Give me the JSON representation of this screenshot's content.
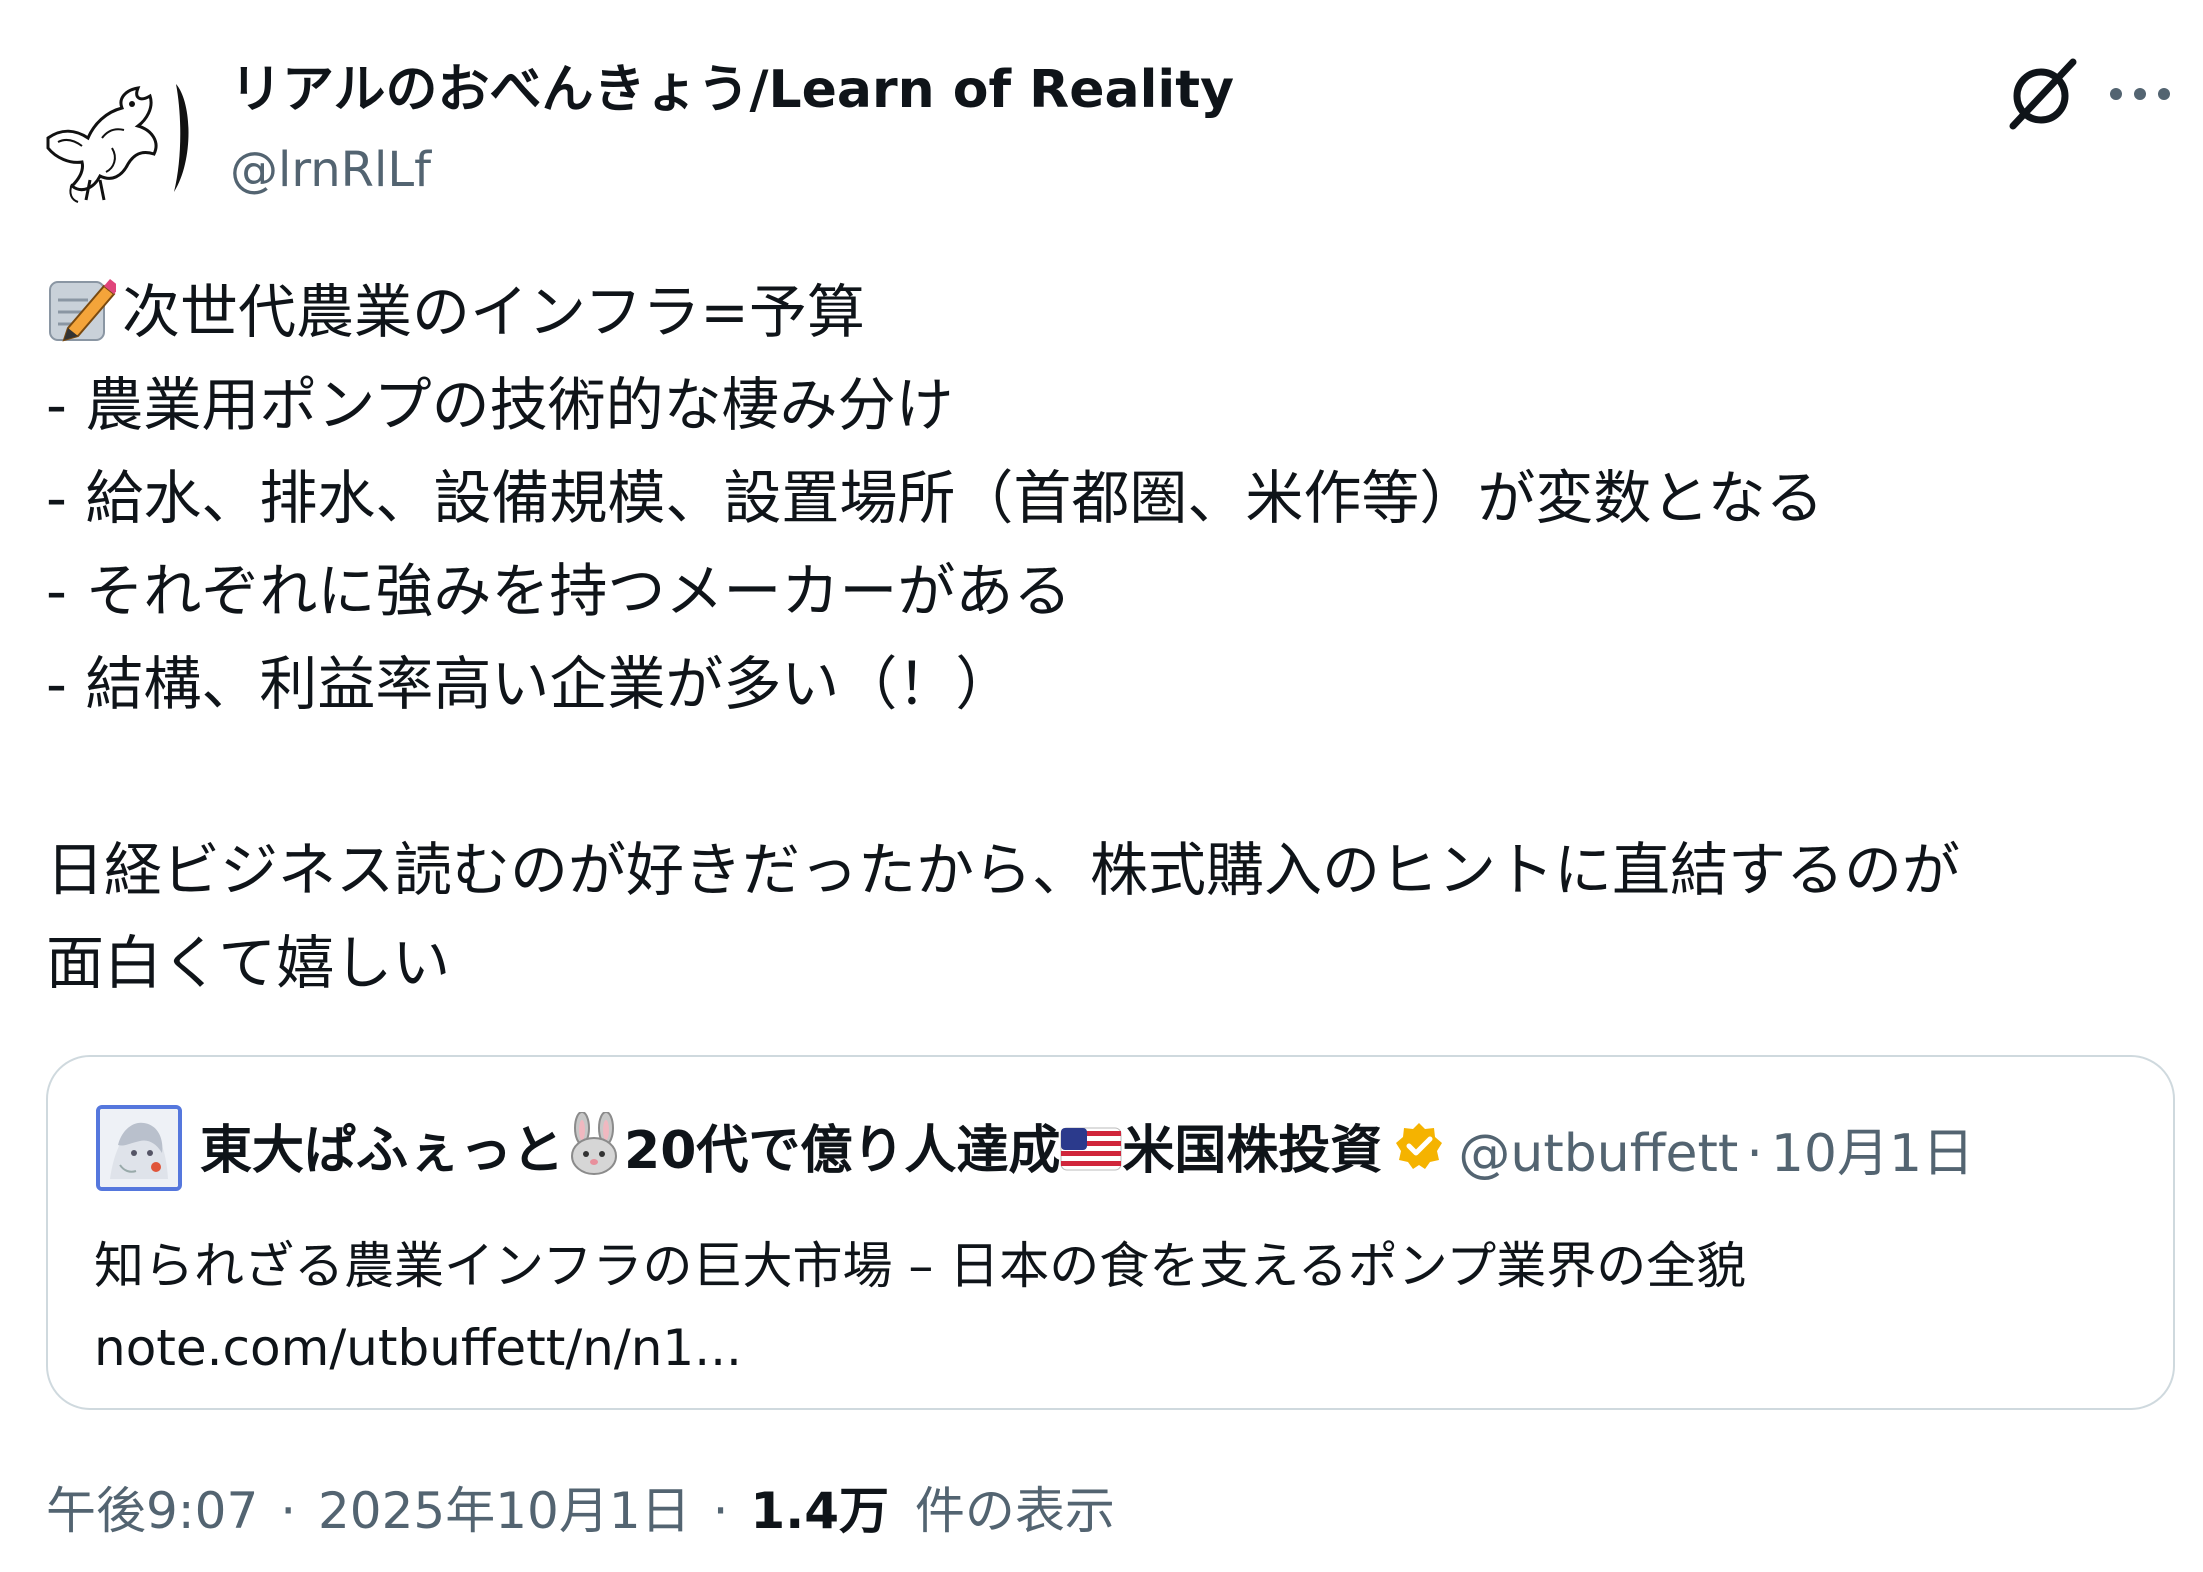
{
  "author": {
    "display_name": "リアルのおべんきょう/Learn of Reality",
    "handle": "@lrnRlLf"
  },
  "icons": {
    "avatar": "bird-sketch-avatar",
    "grok": "grok-icon",
    "more": "more-dots-icon",
    "memo": "memo-pencil-icon",
    "rabbit": "rabbit-icon",
    "flag": "us-flag-icon",
    "verified": "verified-badge-icon"
  },
  "tweet": {
    "lines": [
      "次世代農業のインフラ=予算",
      "- 農業用ポンプの技術的な棲み分け",
      "- 給水、排水、設備規模、設置場所（首都圏、米作等）が変数となる",
      "- それぞれに強みを持つメーカーがある",
      "- 結構、利益率高い企業が多い（！）",
      "",
      "日経ビジネス読むのが好きだったから、株式購入のヒントに直結するのが",
      "面白くて嬉しい"
    ]
  },
  "quote": {
    "name_part1": "東大ぱふぇっと",
    "name_part2": "20代で億り人達成",
    "name_part3": "米国株投資",
    "handle": "@utbuffett",
    "separator": "·",
    "date": "10月1日",
    "text": "知られざる農業インフラの巨大市場 – 日本の食を支えるポンプ業界の全貌",
    "link": "note.com/utbuffett/n/n1..."
  },
  "meta": {
    "time": "午後9:07",
    "separator": "·",
    "date": "2025年10月1日",
    "views_count": "1.4万",
    "views_label": "件の表示"
  },
  "colors": {
    "text": "#0f1419",
    "secondary": "#536471",
    "border": "#cfd9de",
    "verified": "#f5b300"
  }
}
